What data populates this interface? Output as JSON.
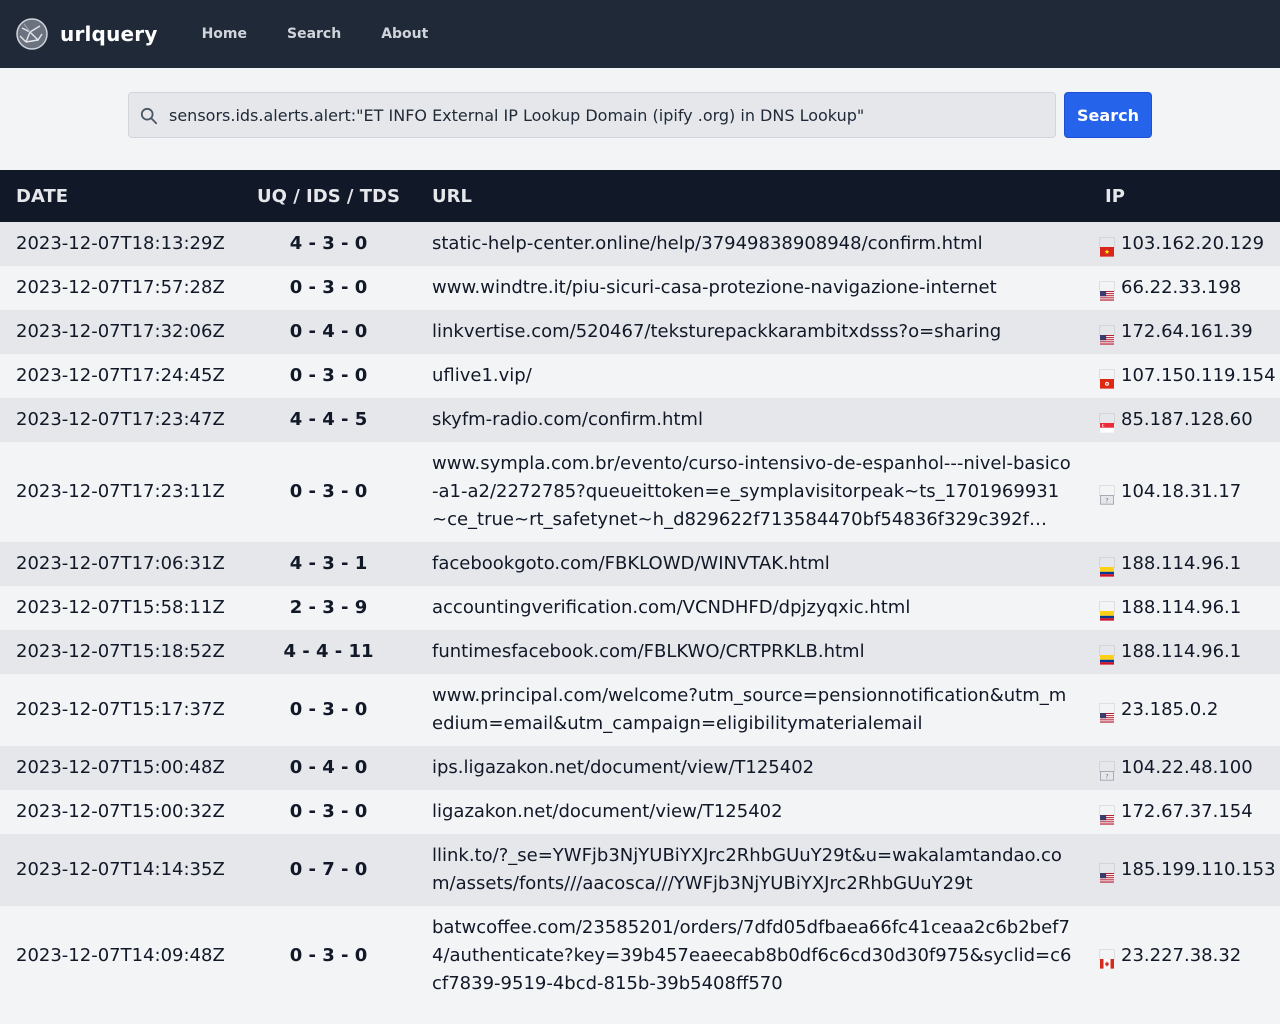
{
  "header": {
    "brand": "urlquery",
    "nav": [
      {
        "label": "Home"
      },
      {
        "label": "Search"
      },
      {
        "label": "About"
      }
    ]
  },
  "search": {
    "query": "sensors.ids.alerts.alert:\"ET INFO External IP Lookup Domain (ipify .org) in DNS Lookup\"",
    "button_label": "Search"
  },
  "table": {
    "headers": {
      "date": "DATE",
      "score": "UQ / IDS / TDS",
      "url": "URL",
      "ip": "IP"
    },
    "rows": [
      {
        "date": "2023-12-07T18:13:29Z",
        "score": "4 - 3 - 0",
        "url": "static-help-center.online/help/37949838908948/confirm.html",
        "flag": "vn",
        "ip": "103.162.20.129"
      },
      {
        "date": "2023-12-07T17:57:28Z",
        "score": "0 - 3 - 0",
        "url": "www.windtre.it/piu-sicuri-casa-protezione-navigazione-internet",
        "flag": "us",
        "ip": "66.22.33.198"
      },
      {
        "date": "2023-12-07T17:32:06Z",
        "score": "0 - 4 - 0",
        "url": "linkvertise.com/520467/teksturepackkarambitxdsss?o=sharing",
        "flag": "us",
        "ip": "172.64.161.39"
      },
      {
        "date": "2023-12-07T17:24:45Z",
        "score": "0 - 3 - 0",
        "url": "uflive1.vip/",
        "flag": "hk",
        "ip": "107.150.119.154"
      },
      {
        "date": "2023-12-07T17:23:47Z",
        "score": "4 - 4 - 5",
        "url": "skyfm-radio.com/confirm.html",
        "flag": "sg",
        "ip": "85.187.128.60"
      },
      {
        "date": "2023-12-07T17:23:11Z",
        "score": "0 - 3 - 0",
        "url": "www.sympla.com.br/evento/curso-intensivo-de-espanhol---nivel-basico-a1-a2/2272785?queueittoken=e_symplavisitorpeak~ts_1701969931~ce_true~rt_safetynet~h_d829622f713584470bf54836f329c392f…",
        "flag": "unknown",
        "ip": "104.18.31.17"
      },
      {
        "date": "2023-12-07T17:06:31Z",
        "score": "4 - 3 - 1",
        "url": "facebookgoto.com/FBKLOWD/WINVTAK.html",
        "flag": "co",
        "ip": "188.114.96.1"
      },
      {
        "date": "2023-12-07T15:58:11Z",
        "score": "2 - 3 - 9",
        "url": "accountingverification.com/VCNDHFD/dpjzyqxic.html",
        "flag": "co",
        "ip": "188.114.96.1"
      },
      {
        "date": "2023-12-07T15:18:52Z",
        "score": "4 - 4 - 11",
        "url": "funtimesfacebook.com/FBLKWO/CRTPRKLB.html",
        "flag": "co",
        "ip": "188.114.96.1"
      },
      {
        "date": "2023-12-07T15:17:37Z",
        "score": "0 - 3 - 0",
        "url": "www.principal.com/welcome?utm_source=pensionnotification&utm_medium=email&utm_campaign=eligibilitymaterialemail",
        "flag": "us",
        "ip": "23.185.0.2"
      },
      {
        "date": "2023-12-07T15:00:48Z",
        "score": "0 - 4 - 0",
        "url": "ips.ligazakon.net/document/view/T125402",
        "flag": "unknown",
        "ip": "104.22.48.100"
      },
      {
        "date": "2023-12-07T15:00:32Z",
        "score": "0 - 3 - 0",
        "url": "ligazakon.net/document/view/T125402",
        "flag": "us",
        "ip": "172.67.37.154"
      },
      {
        "date": "2023-12-07T14:14:35Z",
        "score": "0 - 7 - 0",
        "url": "llink.to/?_se=YWFjb3NjYUBiYXJrc2RhbGUuY29t&u=wakalamtandao.com/assets/fonts///aacosca///YWFjb3NjYUBiYXJrc2RhbGUuY29t",
        "flag": "us",
        "ip": "185.199.110.153"
      },
      {
        "date": "2023-12-07T14:09:48Z",
        "score": "0 - 3 - 0",
        "url": "batwcoffee.com/23585201/orders/7dfd05dfbaea66fc41ceaa2c6b2bef74/authenticate?key=39b457eaeecab8b0df6c6cd30d30f975&syclid=c6cf7839-9519-4bcd-815b-39b5408ff570",
        "flag": "ca",
        "ip": "23.227.38.32"
      }
    ]
  },
  "colors": {
    "nav_bg": "#1f2937",
    "table_header_bg": "#111827",
    "accent": "#2563eb",
    "row_odd": "#e5e7eb",
    "row_even": "#f3f4f6"
  }
}
